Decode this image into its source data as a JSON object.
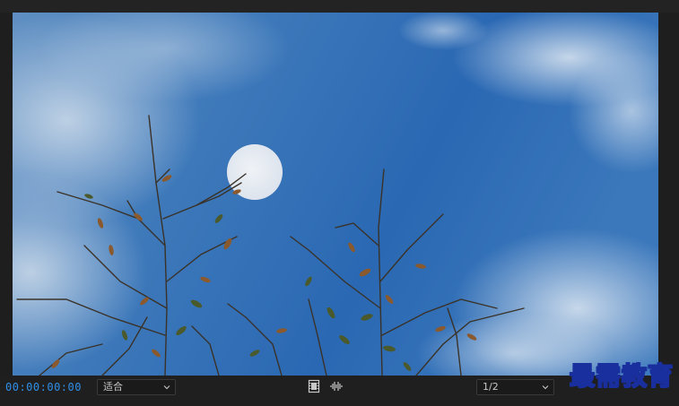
{
  "playback": {
    "timecode": "00:00:00:00"
  },
  "controls": {
    "fit_label": "适合",
    "resolution_label": "1/2",
    "export_frame_icon": "film-frame-icon",
    "audio_waveform_icon": "waveform-icon",
    "dropdown_icon": "chevron-down-icon"
  },
  "watermark": {
    "text": "最需教育"
  },
  "colors": {
    "timecode": "#2f8fe8",
    "panel_background": "#1e1e1e",
    "sky": "#2d6bb0"
  }
}
